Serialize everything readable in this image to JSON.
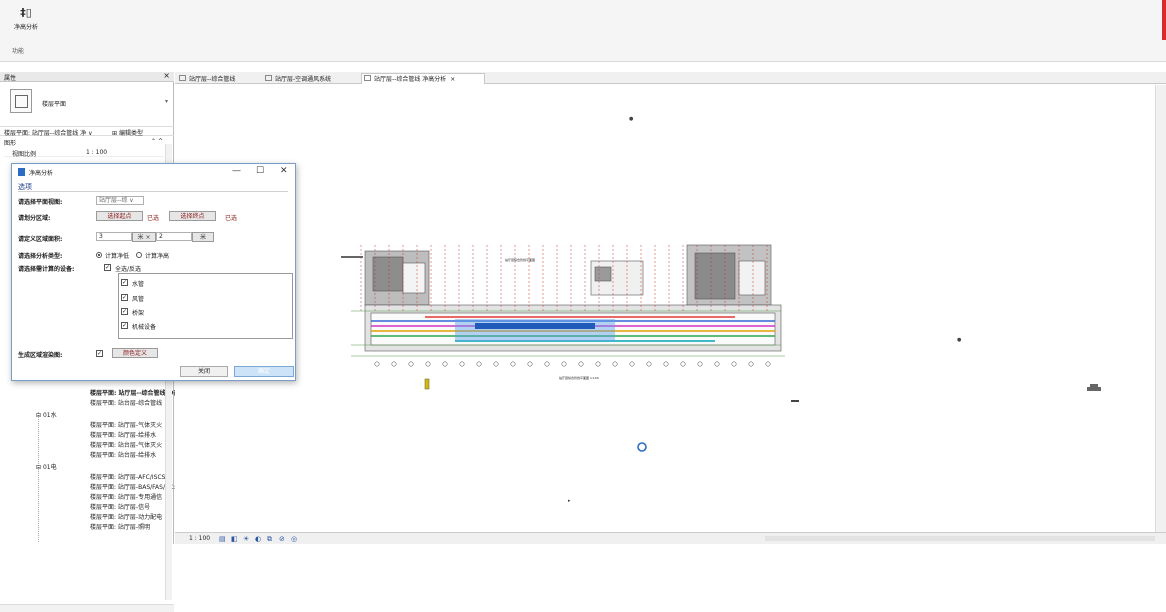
{
  "ribbon": {
    "tool_glyph": "‡▯",
    "tool_label": "净高分析",
    "panel_label": "功能"
  },
  "props": {
    "title": "属性",
    "type_name": "楼层平面",
    "instance_selector": "楼层平面: 站厅层--综合管线 净 ∨",
    "edit_type": "编辑类型",
    "group": "图形",
    "group_toggle": "⌃ ^",
    "rows": [
      {
        "key": "视图比例",
        "value": "1 : 100"
      }
    ]
  },
  "tree": {
    "items": [
      {
        "text": "楼层平面: 站厅层--综合管线 净高",
        "current": true
      },
      {
        "text": "楼层平面: 站台层-综合管线"
      },
      {
        "text": "01水",
        "folder": true
      },
      {
        "text": "楼层平面: 站厅层-气体灭火"
      },
      {
        "text": "楼层平面: 站厅层-给排水"
      },
      {
        "text": "楼层平面: 站台层-气体灭火"
      },
      {
        "text": "楼层平面: 站台层-给排水"
      },
      {
        "text": "01电",
        "folder": true
      },
      {
        "text": "楼层平面: 站厅层-AFC/ISCS"
      },
      {
        "text": "楼层平面: 站厅层-BAS/FAS/AC:"
      },
      {
        "text": "楼层平面: 站厅层-专用通信"
      },
      {
        "text": "楼层平面: 站厅层-信号"
      },
      {
        "text": "楼层平面: 站厅层-动力配电"
      },
      {
        "text": "楼层平面: 站厅层-照明"
      }
    ]
  },
  "tabs": [
    {
      "label": "站厅层--综合管线"
    },
    {
      "label": "站厅层-空调通风系统"
    },
    {
      "label": "站厅层--综合管线 净高分析",
      "active": true,
      "close": "×"
    }
  ],
  "viewbar": {
    "scale": "1 : 100"
  },
  "dialog": {
    "title": "净高分析",
    "window_buttons": {
      "min": "—",
      "max": "☐",
      "close": "✕"
    },
    "section": "选项",
    "plan_view_label": "请选择平面视图:",
    "plan_view_value": "站厅层--综 ∨",
    "region_label": "请划分区域:",
    "select_start": "选择起点",
    "start_status": "已选",
    "select_end": "选择终点",
    "end_status": "已选",
    "area_label": "请定义区域面积:",
    "area_x": "3",
    "unit_x": "米 ×",
    "area_y": "2",
    "unit_y": "米",
    "analysis_label": "请选择分析类型:",
    "radio_low": "计算净低",
    "radio_high": "计算净高",
    "devices_label": "请选择需计算的设备:",
    "select_all": "全选/反选",
    "devices": [
      "水管",
      "风管",
      "桥架",
      "机械设备"
    ],
    "render_label": "生成区域渲染图:",
    "color_btn": "颜色定义",
    "close_btn": "关闭",
    "ok_btn": "确定",
    "checked": true
  },
  "canvas": {
    "accent": "#2b6cc4",
    "redbar": "#d92b2b",
    "drawing": {
      "plan_title": "站厅层综合管线平面图",
      "caption": "站厅层综合管线平面图 1:100"
    }
  }
}
